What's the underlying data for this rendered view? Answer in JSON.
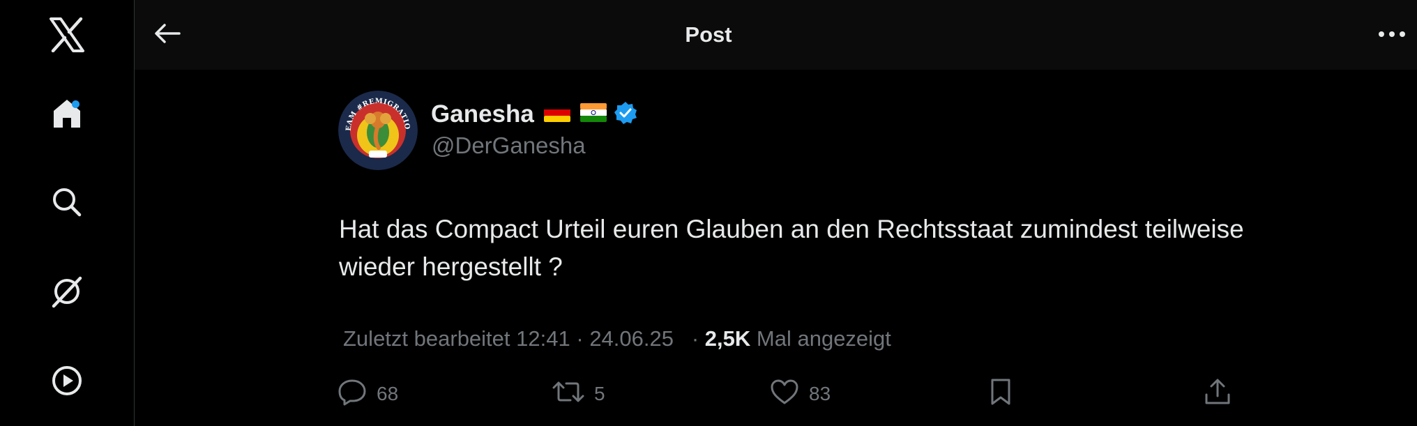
{
  "header": {
    "title": "Post"
  },
  "nav": {
    "items": [
      {
        "icon": "x-logo-icon"
      },
      {
        "icon": "home-icon",
        "has_notification": true
      },
      {
        "icon": "search-icon"
      },
      {
        "icon": "grok-icon"
      },
      {
        "icon": "play-icon"
      }
    ]
  },
  "post": {
    "author": {
      "name": "Ganesha",
      "handle": "@DerGanesha",
      "flags": [
        "de-flag",
        "in-flag"
      ],
      "verified": true,
      "avatar_badge": "TEAM #REMIGRATION"
    },
    "text": "Hat das Compact Urteil euren Glauben an den Rechtsstaat zumindest teilweise wieder hergestellt ?",
    "meta": {
      "edited_label": "Zuletzt bearbeitet",
      "time": "12:41",
      "separator": "·",
      "date": "24.06.25",
      "views_count": "2,5K",
      "views_label": "Mal angezeigt"
    },
    "actions": {
      "replies": "68",
      "reposts": "5",
      "likes": "83"
    }
  },
  "colors": {
    "background": "#000000",
    "text_primary": "#e7e9ea",
    "text_secondary": "#71767b",
    "accent": "#1d9bf0"
  }
}
